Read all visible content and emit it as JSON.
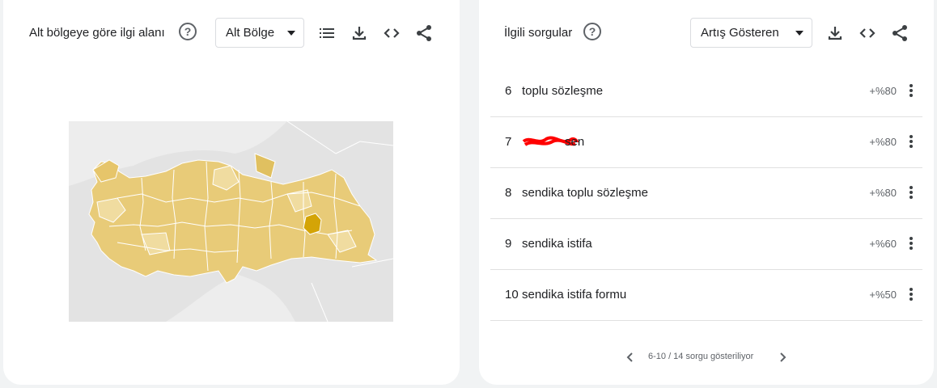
{
  "regional": {
    "title": "Alt bölgeye göre ilgi alanı",
    "help_icon": "help-circle-icon",
    "dropdown_value": "Alt Bölge",
    "icons": [
      "list-icon",
      "download-icon",
      "embed-icon",
      "share-icon"
    ]
  },
  "related": {
    "title": "İlgili sorgular",
    "help_icon": "help-circle-icon",
    "dropdown_value": "Artış Gösteren",
    "icons": [
      "download-icon",
      "embed-icon",
      "share-icon"
    ],
    "queries": [
      {
        "rank": "6",
        "text": "toplu sözleşme",
        "value": "+%80"
      },
      {
        "rank": "7",
        "text": "sen",
        "value": "+%80",
        "redacted": true
      },
      {
        "rank": "8",
        "text": "sendika toplu sözleşme",
        "value": "+%80"
      },
      {
        "rank": "9",
        "text": "sendika istifa",
        "value": "+%60"
      },
      {
        "rank": "10",
        "text": "sendika istifa formu",
        "value": "+%50"
      }
    ],
    "pagination": "6-10 / 14 sorgu gösteriliyor"
  },
  "colors": {
    "map_fill": "#e8cb78",
    "map_fill_light": "#f0dca0",
    "map_highlight": "#d4a406",
    "map_background": "#e3e3e3",
    "redaction": "#ff0000"
  }
}
